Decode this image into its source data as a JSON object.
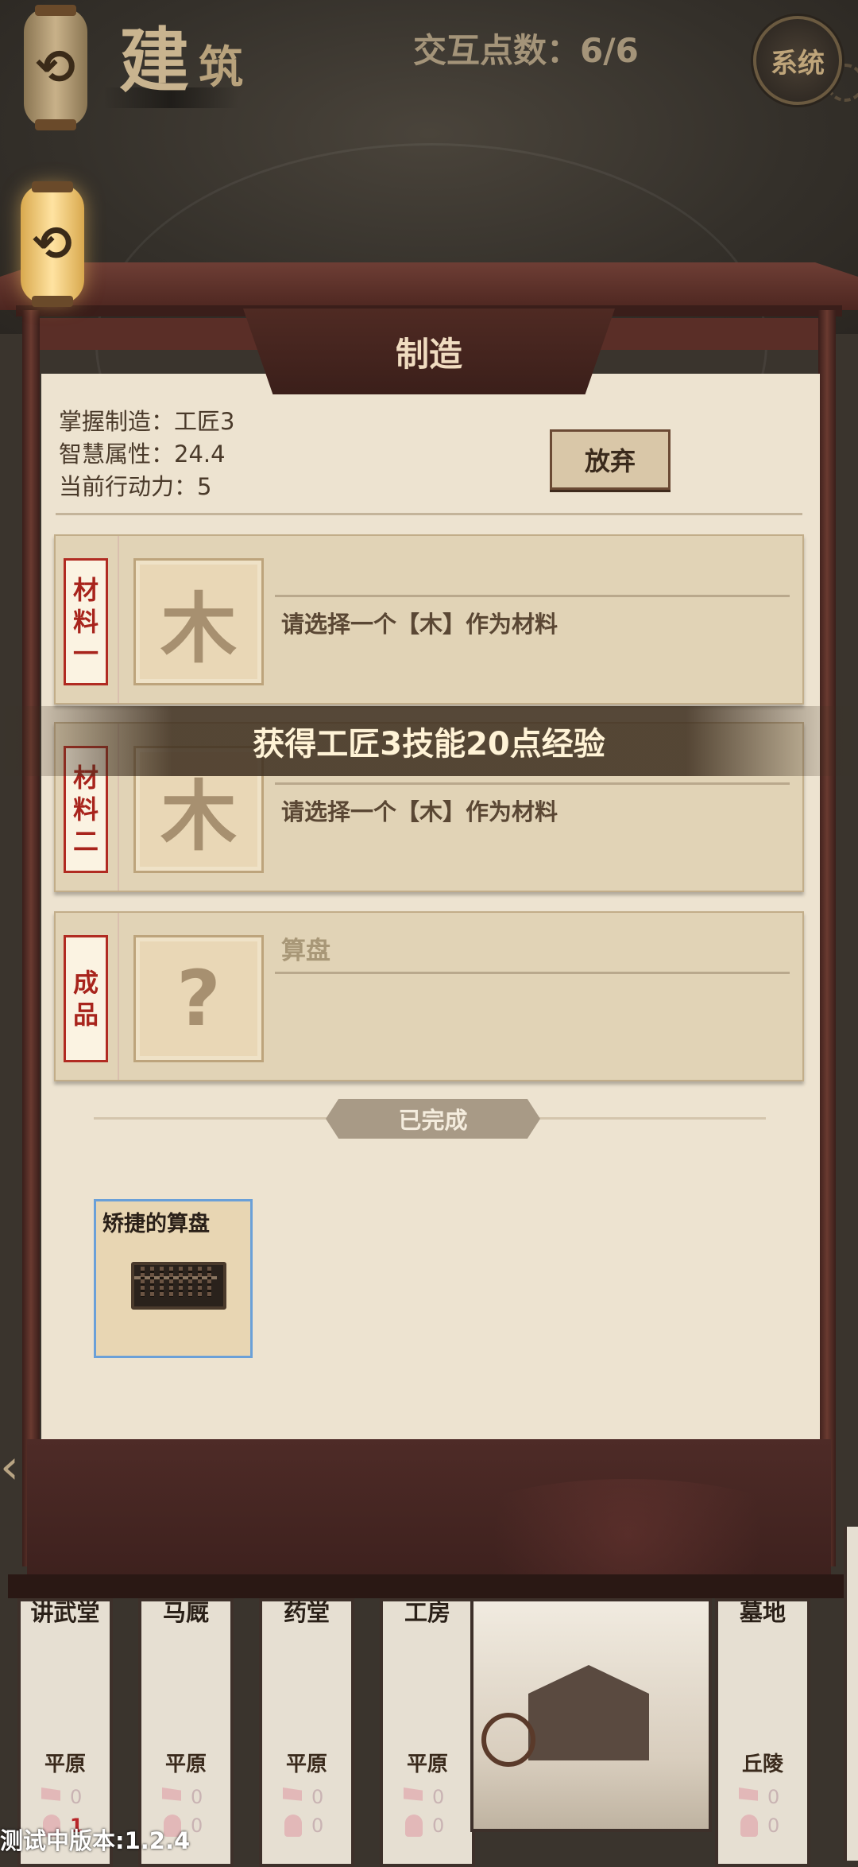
{
  "header": {
    "title_main": "建",
    "title_small": "筑",
    "interaction_points": "交互点数：6/6",
    "system_label": "系统"
  },
  "panel": {
    "title": "制造",
    "stats": {
      "skill": "掌握制造：工匠3",
      "wisdom": "智慧属性：24.4",
      "action": "当前行动力：5"
    },
    "abandon_label": "放弃",
    "slots": [
      {
        "tag": [
          "材",
          "料",
          "一"
        ],
        "glyph": "木",
        "hint": "请选择一个【木】作为材料"
      },
      {
        "tag": [
          "材",
          "料",
          "二"
        ],
        "glyph": "木",
        "hint": "请选择一个【木】作为材料"
      },
      {
        "tag": [
          "成",
          "品"
        ],
        "glyph": "?",
        "name": "算盘"
      }
    ],
    "toast": "获得工匠3技能20点经验",
    "completed_label": "已完成",
    "completed_items": [
      {
        "name": "矫捷的算盘",
        "icon": "abacus-icon"
      }
    ]
  },
  "buildings": [
    {
      "name": "讲武堂",
      "terrain": "平原",
      "flags": "0",
      "people": "1"
    },
    {
      "name": "马厩",
      "terrain": "平原",
      "flags": "0",
      "people": "0"
    },
    {
      "name": "药堂",
      "terrain": "平原",
      "flags": "0",
      "people": "0"
    },
    {
      "name": "工房",
      "terrain": "平原",
      "flags": "0",
      "people": "0"
    },
    {
      "name": "墓地",
      "terrain": "丘陵",
      "flags": "0",
      "people": "0"
    }
  ],
  "footer": {
    "version": "测试中版本:1.2.4"
  },
  "colors": {
    "tag_red": "#a8241c",
    "paper": "#ede3d0",
    "frame": "#4e2b27",
    "selection_blue": "#6aa0d8"
  }
}
